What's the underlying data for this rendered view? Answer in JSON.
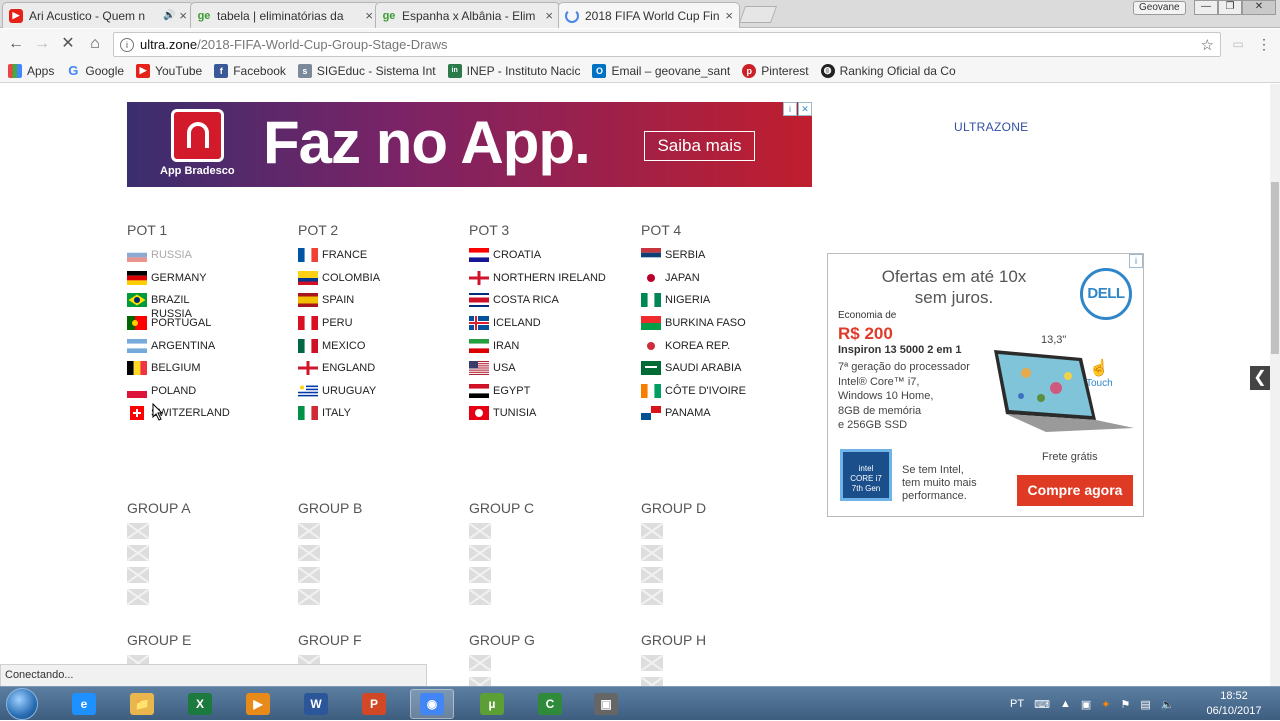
{
  "browser": {
    "tabs": [
      {
        "title": "Ari Acustico - Quem n",
        "icon": "youtube-icon",
        "audio": "🔊"
      },
      {
        "title": "tabela | eliminatórias da",
        "icon": "ge-icon"
      },
      {
        "title": "Espanha x Albânia - Elim",
        "icon": "ge-icon"
      },
      {
        "title": "2018 FIFA World Cup Fin",
        "icon": "loading-icon"
      }
    ],
    "profile_name": "Geovane",
    "url_host": "ultra.zone",
    "url_path": "/2018-FIFA-World-Cup-Group-Stage-Draws",
    "bookmarks": [
      {
        "label": "Apps",
        "icon": "apps-grid-icon"
      },
      {
        "label": "Google",
        "icon": "google-icon"
      },
      {
        "label": "YouTube",
        "icon": "youtube-icon"
      },
      {
        "label": "Facebook",
        "icon": "facebook-icon"
      },
      {
        "label": "SIGEduc - Sistema Int",
        "icon": "sigeduc-icon"
      },
      {
        "label": "INEP - Instituto Nacic",
        "icon": "inep-icon"
      },
      {
        "label": "Email – geovane_sant",
        "icon": "outlook-icon"
      },
      {
        "label": "Pinterest",
        "icon": "pinterest-icon"
      },
      {
        "label": "Ranking Oficial da Co",
        "icon": "soccer-ball-icon"
      }
    ],
    "status_text": "Conectando..."
  },
  "ad_top": {
    "brand": "App Bradesco",
    "headline": "Faz no App.",
    "cta": "Saiba mais"
  },
  "side_link": "ULTRAZONE",
  "pots": [
    {
      "title": "POT 1",
      "teams": [
        {
          "name": "RUSSIA",
          "flag": [
            "#ffffff",
            "#1c57a7",
            "#d52b1e"
          ],
          "type": "h3",
          "faded": true
        },
        {
          "name": "GERMANY",
          "flag": [
            "#000000",
            "#dd0000",
            "#ffce00"
          ],
          "type": "h3"
        },
        {
          "name": "BRAZIL",
          "flag": [
            "#009c3b",
            "#ffdf00",
            "#002776"
          ],
          "type": "diamond"
        },
        {
          "name": "PORTUGAL",
          "flag": [
            "#006600",
            "#ff0000",
            "#ffcc00"
          ],
          "type": "pt"
        },
        {
          "name": "ARGENTINA",
          "flag": [
            "#75aadb",
            "#ffffff",
            "#75aadb"
          ],
          "type": "h3"
        },
        {
          "name": "BELGIUM",
          "flag": [
            "#000000",
            "#fdda24",
            "#ef3340"
          ],
          "type": "v3"
        },
        {
          "name": "POLAND",
          "flag": [
            "#ffffff",
            "#dc143c"
          ],
          "type": "h2"
        },
        {
          "name": "SWITZERLAND",
          "flag": [
            "#ff0000",
            "#ffffff"
          ],
          "type": "swiss"
        }
      ]
    },
    {
      "title": "POT 2",
      "teams": [
        {
          "name": "FRANCE",
          "flag": [
            "#0055a4",
            "#ffffff",
            "#ef4135"
          ],
          "type": "v3"
        },
        {
          "name": "COLOMBIA",
          "flag": [
            "#fcd116",
            "#003893",
            "#ce1126"
          ],
          "type": "co"
        },
        {
          "name": "SPAIN",
          "flag": [
            "#aa151b",
            "#f1bf00",
            "#aa151b"
          ],
          "type": "es"
        },
        {
          "name": "PERU",
          "flag": [
            "#d91023",
            "#ffffff",
            "#d91023"
          ],
          "type": "v3"
        },
        {
          "name": "MEXICO",
          "flag": [
            "#006847",
            "#ffffff",
            "#ce1126"
          ],
          "type": "v3"
        },
        {
          "name": "ENGLAND",
          "flag": [
            "#ffffff",
            "#cf142b"
          ],
          "type": "cross"
        },
        {
          "name": "URUGUAY",
          "flag": [
            "#ffffff",
            "#0038a8"
          ],
          "type": "stripes"
        },
        {
          "name": "ITALY",
          "flag": [
            "#009246",
            "#ffffff",
            "#ce2b37"
          ],
          "type": "v3"
        }
      ]
    },
    {
      "title": "POT 3",
      "teams": [
        {
          "name": "CROATIA",
          "flag": [
            "#ff0000",
            "#ffffff",
            "#171796"
          ],
          "type": "h3"
        },
        {
          "name": "NORTHERN IRELAND",
          "flag": [
            "#ffffff",
            "#cf142b"
          ],
          "type": "cross"
        },
        {
          "name": "COSTA RICA",
          "flag": [
            "#002b7f",
            "#ffffff",
            "#ce1126"
          ],
          "type": "cr"
        },
        {
          "name": "ICELAND",
          "flag": [
            "#02529c",
            "#ffffff",
            "#dc1e35"
          ],
          "type": "nordic"
        },
        {
          "name": "IRAN",
          "flag": [
            "#239f40",
            "#ffffff",
            "#da0000"
          ],
          "type": "h3"
        },
        {
          "name": "USA",
          "flag": [
            "#b22234",
            "#ffffff",
            "#3c3b6e"
          ],
          "type": "us"
        },
        {
          "name": "EGYPT",
          "flag": [
            "#ce1126",
            "#ffffff",
            "#000000"
          ],
          "type": "h3"
        },
        {
          "name": "TUNISIA",
          "flag": [
            "#e70013",
            "#ffffff"
          ],
          "type": "disc"
        }
      ]
    },
    {
      "title": "POT 4",
      "teams": [
        {
          "name": "SERBIA",
          "flag": [
            "#c6363c",
            "#0c4076",
            "#ffffff"
          ],
          "type": "h3"
        },
        {
          "name": "JAPAN",
          "flag": [
            "#ffffff",
            "#bc002d"
          ],
          "type": "disc"
        },
        {
          "name": "NIGERIA",
          "flag": [
            "#008751",
            "#ffffff",
            "#008751"
          ],
          "type": "v3"
        },
        {
          "name": "BURKINA FASO",
          "flag": [
            "#ef2b2d",
            "#009e49"
          ],
          "type": "h2"
        },
        {
          "name": "KOREA REP.",
          "flag": [
            "#ffffff",
            "#cd2e3a"
          ],
          "type": "disc"
        },
        {
          "name": "SAUDI ARABIA",
          "flag": [
            "#006c35",
            "#ffffff"
          ],
          "type": "plain"
        },
        {
          "name": "CÔTE D'IVOIRE",
          "flag": [
            "#f77f00",
            "#ffffff",
            "#009e60"
          ],
          "type": "v3"
        },
        {
          "name": "PANAMA",
          "flag": [
            "#ffffff",
            "#da121a",
            "#005293"
          ],
          "type": "pa"
        }
      ]
    }
  ],
  "dragged_label": "RUSSIA",
  "groups_row1": [
    "GROUP A",
    "GROUP B",
    "GROUP C",
    "GROUP D"
  ],
  "groups_row2": [
    "GROUP E",
    "GROUP F",
    "GROUP G",
    "GROUP H"
  ],
  "ad_side": {
    "tagline": "Ofertas em até 10x sem juros.",
    "logo": "DELL",
    "economy_label": "Economia de",
    "price": "R$ 200",
    "model": "Inspiron 13 5000 2 em 1",
    "specs": "7ª geração do processador\nIntel® Core™ i7,\nWindows 10 Home,\n8GB de memória\ne 256GB SSD",
    "screen_size": "13,3\"",
    "touch": "Touch",
    "shipping": "Frete grátis",
    "intel_badge": "intel\nCORE i7\n7th Gen",
    "intel_text": "Se tem Intel,\ntem muito mais\nperformance.",
    "cta": "Compre agora"
  },
  "taskbar": {
    "apps": [
      {
        "name": "ie-icon",
        "label": "e",
        "color": "#1e90ff"
      },
      {
        "name": "explorer-icon",
        "label": "📁",
        "color": "#e8b64c"
      },
      {
        "name": "excel-icon",
        "label": "X",
        "color": "#1d7a3e"
      },
      {
        "name": "media-player-icon",
        "label": "▶",
        "color": "#e88a1a"
      },
      {
        "name": "word-icon",
        "label": "W",
        "color": "#2b579a"
      },
      {
        "name": "powerpoint-icon",
        "label": "P",
        "color": "#d24726"
      },
      {
        "name": "chrome-icon",
        "label": "◉",
        "color": "#4285f4"
      },
      {
        "name": "utorrent-icon",
        "label": "µ",
        "color": "#5ca035"
      },
      {
        "name": "camtasia-icon",
        "label": "C",
        "color": "#2f8a3a"
      },
      {
        "name": "cmd-icon",
        "label": "▣",
        "color": "#666666"
      }
    ],
    "lang": "PT",
    "time": "18:52",
    "date": "06/10/2017"
  }
}
